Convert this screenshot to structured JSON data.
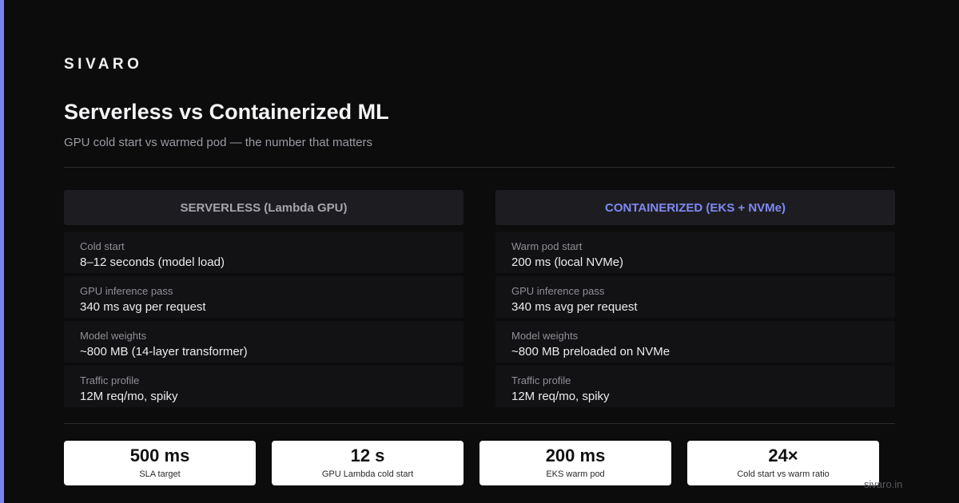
{
  "brand": "SIVARO",
  "title": "Serverless vs Containerized ML",
  "subtitle": "GPU cold start vs warmed pod — the number that matters",
  "colors": {
    "accent": "#7b84ee",
    "background": "#0c0c0d",
    "containerized_header": "#8088f2"
  },
  "columns": [
    {
      "header": "SERVERLESS (Lambda GPU)",
      "rows": [
        {
          "label": "Cold start",
          "value": "8–12 seconds (model load)"
        },
        {
          "label": "GPU inference pass",
          "value": "340 ms avg per request"
        },
        {
          "label": "Model weights",
          "value": "~800 MB (14-layer transformer)"
        },
        {
          "label": "Traffic profile",
          "value": "12M req/mo, spiky"
        }
      ]
    },
    {
      "header": "CONTAINERIZED (EKS + NVMe)",
      "rows": [
        {
          "label": "Warm pod start",
          "value": "200 ms (local NVMe)"
        },
        {
          "label": "GPU inference pass",
          "value": "340 ms avg per request"
        },
        {
          "label": "Model weights",
          "value": "~800 MB preloaded on NVMe"
        },
        {
          "label": "Traffic profile",
          "value": "12M req/mo, spiky"
        }
      ]
    }
  ],
  "stats": [
    {
      "value": "500 ms",
      "label": "SLA target"
    },
    {
      "value": "12 s",
      "label": "GPU Lambda cold start"
    },
    {
      "value": "200 ms",
      "label": "EKS warm pod"
    },
    {
      "value": "24×",
      "label": "Cold start vs warm ratio"
    }
  ],
  "footer_url": "sivaro.in"
}
